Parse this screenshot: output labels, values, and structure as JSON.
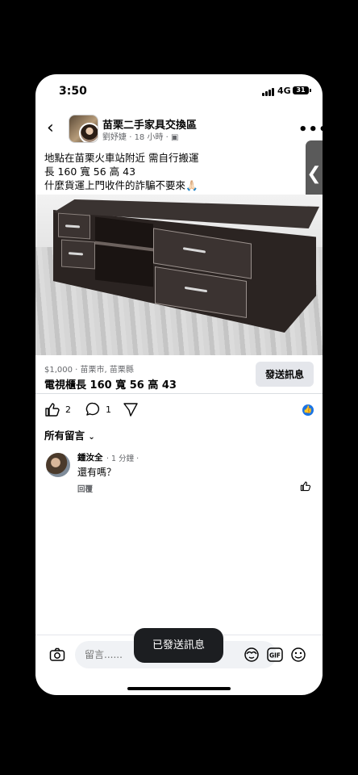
{
  "status": {
    "time": "3:50",
    "network": "4G",
    "battery": "31"
  },
  "header": {
    "group_name": "苗栗二手家具交換區",
    "author": "劉妤婕",
    "time": "18 小時",
    "separator": "·"
  },
  "post": {
    "text": "地點在苗栗火車站附近 需自行搬運\n長 160 寬 56 高 43\n什麼貨運上門收件的詐騙不要來🙏🏻"
  },
  "listing": {
    "price_location": "$1,000 · 苗栗市, 苗栗縣",
    "title": "電視櫃長 160 寬 56 高 43",
    "send_button": "發送訊息"
  },
  "reactions": {
    "likes": "2",
    "comments": "1"
  },
  "comments_section": {
    "filter_label": "所有留言",
    "comments": [
      {
        "name": "鍾汝全",
        "time": "· 1 分鐘 ·",
        "text": "還有嗎？",
        "reply": "回覆"
      }
    ]
  },
  "composer": {
    "placeholder": "留言......"
  },
  "toast": {
    "text": "已發送訊息"
  },
  "colors": {
    "accent": "#1b74e4",
    "toast_bg": "#1c1e21",
    "button_bg": "#e4e6eb"
  }
}
